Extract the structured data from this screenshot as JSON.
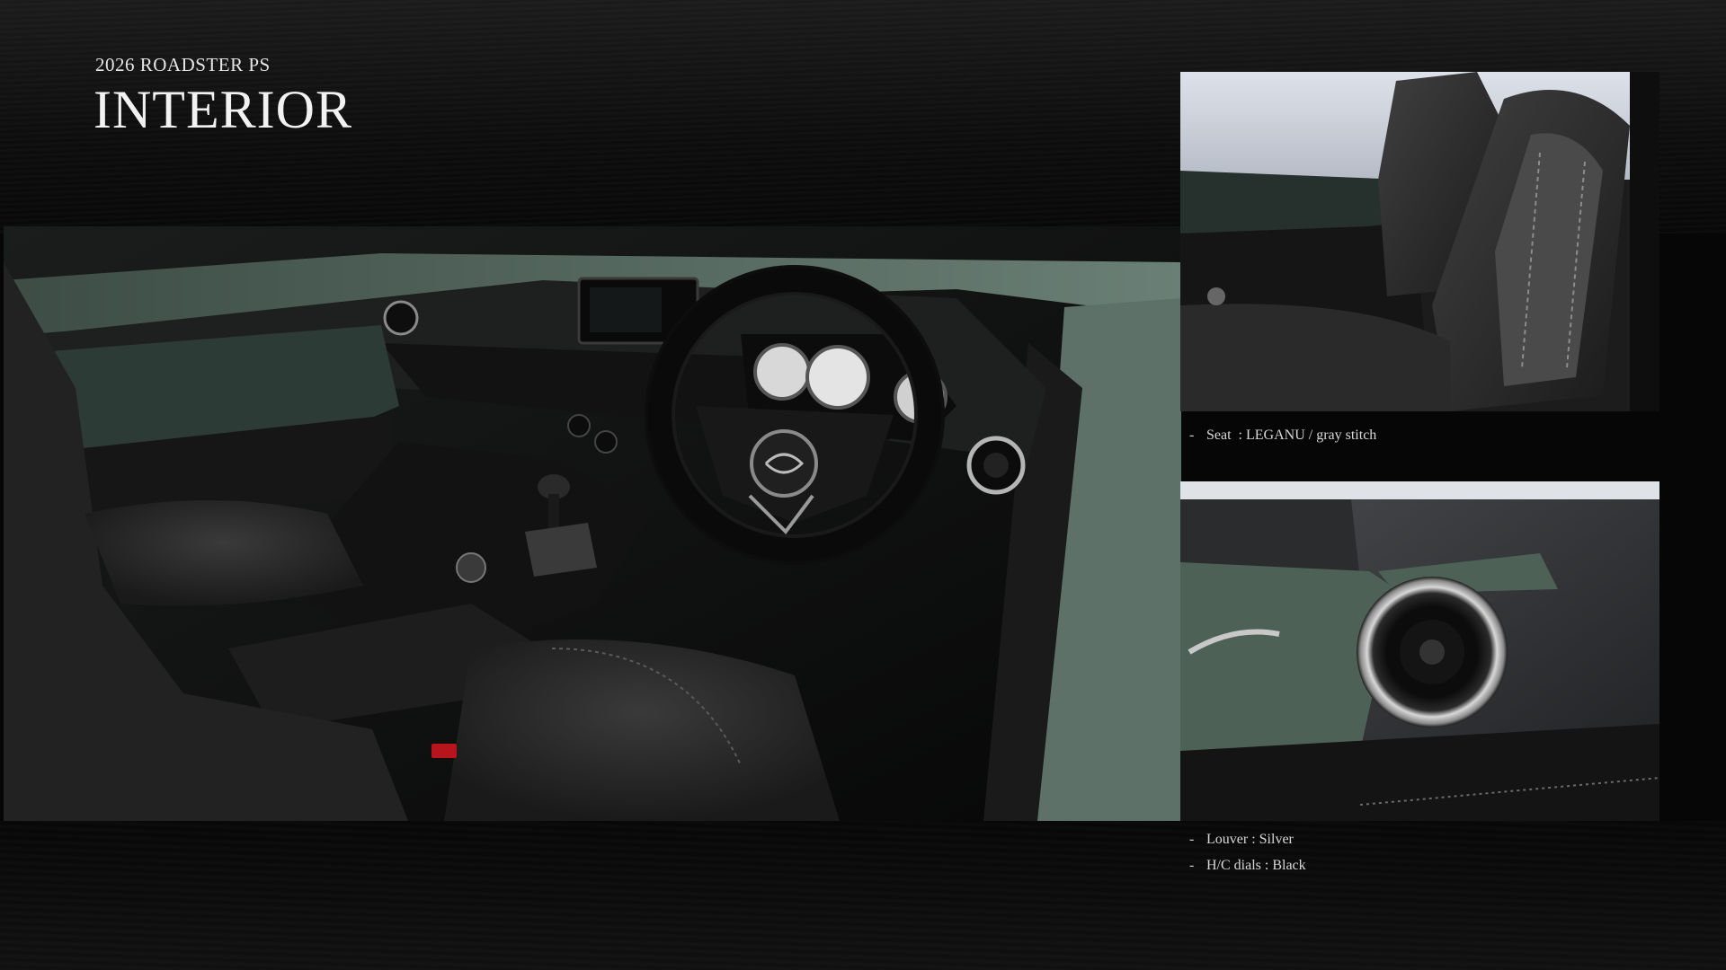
{
  "slide": {
    "eyebrow": "2026 ROADSTER PS",
    "title": "INTERIOR"
  },
  "images": {
    "main": "interior-dashboard-steering-wheel-photo",
    "seat": "seat-closeup-photo",
    "vent": "air-vent-louver-closeup-photo"
  },
  "captions": {
    "seat": {
      "dash": "-",
      "text": "Seat  : LEGANU / gray stitch"
    },
    "louver": {
      "dash": "-",
      "text": "Louver : Silver"
    },
    "dials": {
      "dash": "-",
      "text": "H/C dials : Black"
    }
  },
  "colors": {
    "background": "#060606",
    "body_green": "#56695f",
    "leather": "#2a2a2a"
  }
}
